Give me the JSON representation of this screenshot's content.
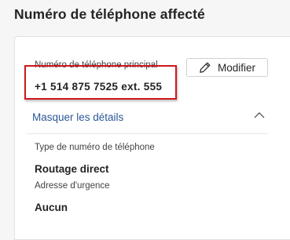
{
  "page": {
    "title": "Numéro de téléphone affecté"
  },
  "primary_number": {
    "label": "Numéro de téléphone principal",
    "value": "+1 514 875 7525 ext. 555"
  },
  "edit_button": {
    "label": "Modifier",
    "icon": "pencil-icon"
  },
  "details_toggle": {
    "label": "Masquer les détails",
    "icon": "chevron-up-icon"
  },
  "details": {
    "number_type": {
      "label": "Type de numéro de téléphone",
      "value": "Routage direct"
    },
    "emergency_address": {
      "label": "Adresse d'urgence",
      "value": "Aucun"
    }
  },
  "colors": {
    "highlight": "#d0161b",
    "link": "#2b5797"
  }
}
